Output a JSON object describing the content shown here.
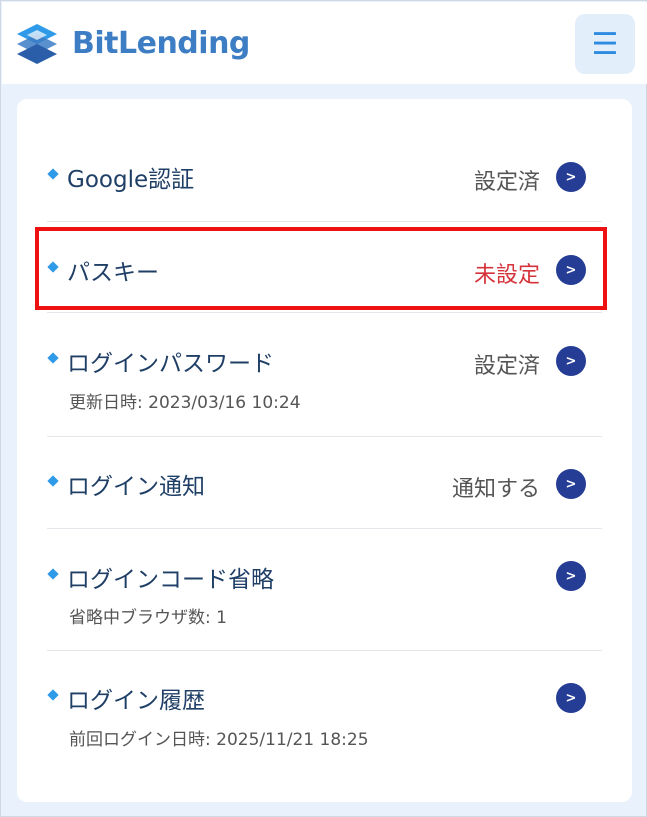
{
  "header": {
    "brand": "BitLending",
    "menu_icon": "hamburger-menu-icon"
  },
  "settings": {
    "items": [
      {
        "label": "Google認証",
        "status": "設定済",
        "sub": ""
      },
      {
        "label": "パスキー",
        "status": "未設定",
        "sub": ""
      },
      {
        "label": "ログインパスワード",
        "status": "設定済",
        "sub": "更新日時: 2023/03/16 10:24"
      },
      {
        "label": "ログイン通知",
        "status": "通知する",
        "sub": ""
      },
      {
        "label": "ログインコード省略",
        "status": "",
        "sub": "省略中ブラウザ数: 1"
      },
      {
        "label": "ログイン履歴",
        "status": "",
        "sub": "前回ログイン日時: 2025/11/21 18:25"
      }
    ]
  },
  "colors": {
    "brand": "#3c7dc4",
    "accent": "#2f9be8",
    "chevron": "#253d95",
    "warning": "#d5333a",
    "highlight": "#ee1111"
  }
}
